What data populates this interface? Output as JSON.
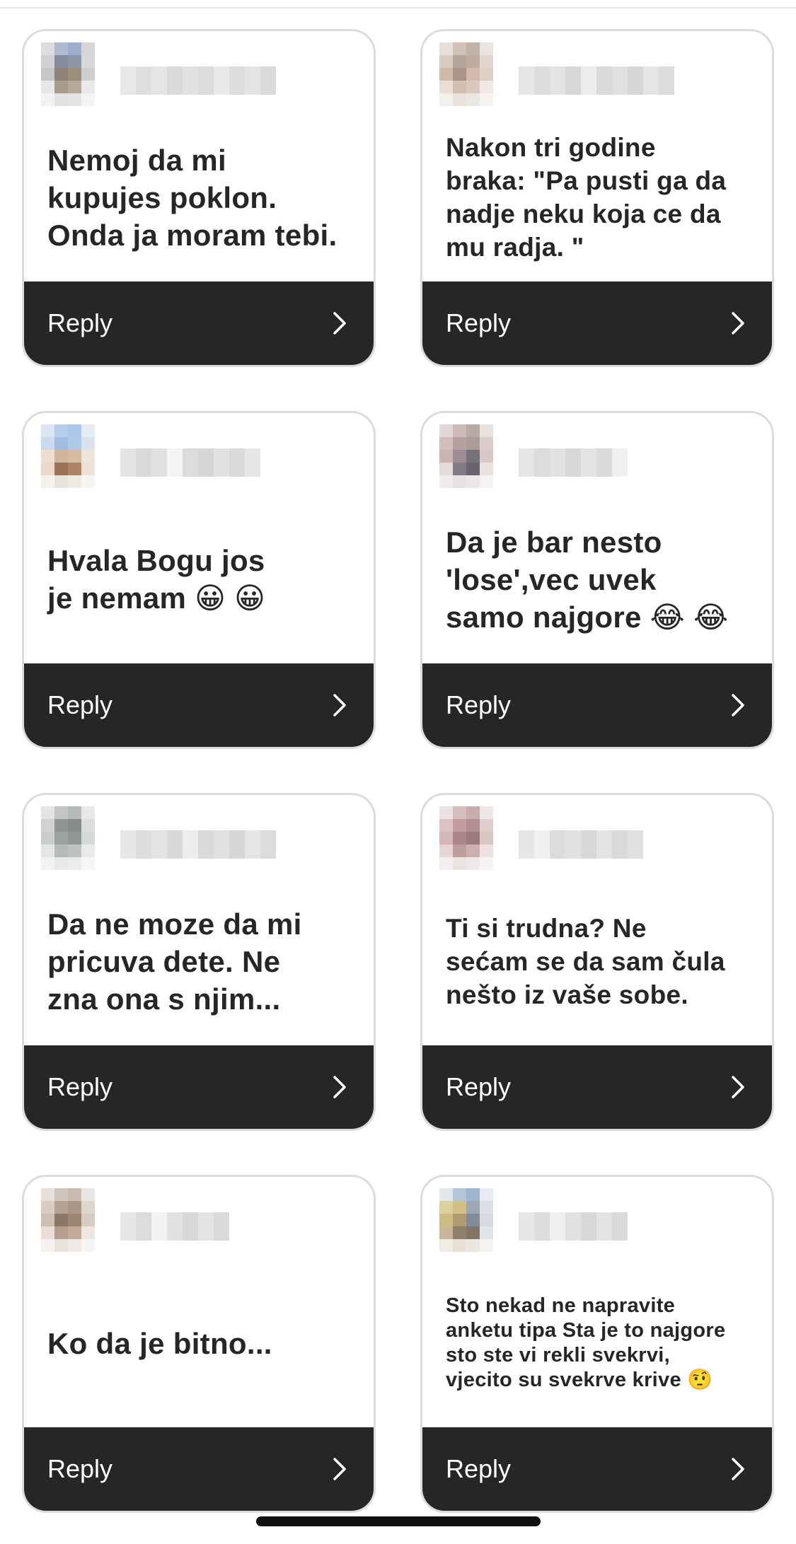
{
  "reply_label": "Reply",
  "cards": [
    {
      "text": "Nemoj da mi\nkupujes poklon.\nOnda ja moram tebi.",
      "size": "large",
      "avatar_colors": [
        "#d8d8d8",
        "#9fb0cc",
        "#8aa0c4",
        "#cfcfcf",
        "#c9c9c9",
        "#6f7a8c",
        "#7c8496",
        "#d2d2d2",
        "#bdbdbd",
        "#7b6e5e",
        "#8c7b66",
        "#c7c7c7",
        "#e3e3e3",
        "#9a8a74",
        "#a89a86",
        "#e6e6e6",
        "#f0f0f0",
        "#dcdcdc",
        "#e0e0e0",
        "#f2f2f2"
      ],
      "username_blocks": [
        "#e8e8e8",
        "#dedede",
        "#e5e5e5",
        "#d9d9d9",
        "#e2e2e2",
        "#dcdcdc",
        "#e9e9e9",
        "#dddddd",
        "#e4e4e4",
        "#dadada"
      ]
    },
    {
      "text": "Nakon tri godine\nbraka: \"Pa pusti ga da\nnadje neku koja ce da\nmu radja. \"",
      "size": "medium",
      "avatar_colors": [
        "#e4dad4",
        "#c9b8ad",
        "#b7a69a",
        "#e6e0da",
        "#d3c2b6",
        "#a8978a",
        "#b69e8c",
        "#dccfc5",
        "#c7ae9c",
        "#9c8271",
        "#c8b09e",
        "#d9c7b9",
        "#e8d9cd",
        "#c9b4a5",
        "#d4c0b1",
        "#eee5de",
        "#f3efeb",
        "#e7ded7",
        "#ebe3dc",
        "#f6f2ef"
      ],
      "username_blocks": [
        "#e6e6e6",
        "#dddddd",
        "#e3e3e3",
        "#d8d8d8",
        "#ececec",
        "#dadada",
        "#e0e0e0",
        "#d6d6d6",
        "#e5e5e5",
        "#dcdcdc"
      ]
    },
    {
      "text": "Hvala Bogu jos\nje nemam 😀 😀",
      "size": "large",
      "avatar_colors": [
        "#d6e2f0",
        "#a9c6ea",
        "#9dbde6",
        "#e2e9f2",
        "#c3d4ea",
        "#8fb2e0",
        "#a4c0e6",
        "#d5dfec",
        "#e9d9c8",
        "#c8a98a",
        "#cfb194",
        "#eae0d6",
        "#e7d2bf",
        "#8a5a3a",
        "#a06e4c",
        "#ecdccc",
        "#f3eee8",
        "#e6dfd8",
        "#ede6df",
        "#f7f3ef"
      ],
      "username_blocks": [
        "#e4e4e4",
        "#d9d9d9",
        "#e0e0e0",
        "#f5f5f5",
        "#dcdcdc",
        "#d6d6d6",
        "#e2e2e2",
        "#dadada",
        "#e6e6e6"
      ]
    },
    {
      "text": "Da je bar nesto\n'lose',vec uvek\nsamo najgore 😂 😂",
      "size": "large",
      "avatar_colors": [
        "#dcd2d0",
        "#c2aeab",
        "#b09a95",
        "#e3dcda",
        "#c9b3ae",
        "#a9918c",
        "#9f8a85",
        "#d4c6c2",
        "#c1a9a4",
        "#8e7a82",
        "#5e5a66",
        "#cfc0bc",
        "#e0d6d3",
        "#6b6470",
        "#4d4a56",
        "#e5dcd9",
        "#efebea",
        "#e2dddc",
        "#e8e3e2",
        "#f4f1f0"
      ],
      "username_blocks": [
        "#e6e6e6",
        "#dcdcdc",
        "#e2e2e2",
        "#d8d8d8",
        "#e4e4e4",
        "#dadada",
        "#f0f0f0"
      ]
    },
    {
      "text": "Da ne moze da mi\npricuva dete. Ne\nzna ona s njim...",
      "size": "large",
      "avatar_colors": [
        "#dfe0df",
        "#b9bcba",
        "#a9adab",
        "#e3e4e3",
        "#c9ccca",
        "#7d8581",
        "#6f7874",
        "#d6d8d7",
        "#c2c5c3",
        "#8a938f",
        "#7e8783",
        "#cfd2d0",
        "#e0e2e1",
        "#a8afab",
        "#b3b9b6",
        "#e6e8e7",
        "#eff0ef",
        "#e4e5e4",
        "#e8e9e8",
        "#f4f5f4"
      ],
      "username_blocks": [
        "#e6e6e6",
        "#dddddd",
        "#e3e3e3",
        "#d8d8d8",
        "#ececec",
        "#dadada",
        "#e0e0e0",
        "#d6d6d6",
        "#e5e5e5",
        "#dcdcdc"
      ]
    },
    {
      "text": "Ti si trudna? Ne\nsećam se da sam čula\nnešto iz vaše sobe.",
      "size": "medium",
      "avatar_colors": [
        "#e8dcdc",
        "#cfb2b2",
        "#c19e9e",
        "#eae2e2",
        "#d6b8b8",
        "#b88c8c",
        "#a87c7c",
        "#dcc6c6",
        "#cfaaa8",
        "#9e7272",
        "#8c6464",
        "#d4bcbc",
        "#e2d0d0",
        "#b48c8a",
        "#c4a2a0",
        "#ecdede",
        "#f3ecec",
        "#e8dede",
        "#ede5e5",
        "#f7f2f2"
      ],
      "username_blocks": [
        "#e6e6e6",
        "#f0f0f0",
        "#dcdcdc",
        "#e2e2e2",
        "#d8d8d8",
        "#e4e4e4",
        "#dadada",
        "#e0e0e0"
      ]
    },
    {
      "text": "Ko da je bitno...",
      "size": "large",
      "avatar_colors": [
        "#e2dcd8",
        "#c8bcb4",
        "#bcae a4",
        "#e6e1dd",
        "#d2c4b9",
        "#a89280",
        "#9c8472",
        "#dacfc6",
        "#c7b4a5",
        "#7a604c",
        "#8c705a",
        "#d2c2b5",
        "#e4dad2",
        "#a88e7a",
        "#b89c86",
        "#ebe3dc",
        "#f3efeb",
        "#e6dfd9",
        "#ebe5e0",
        "#f6f3f0"
      ],
      "username_blocks": [
        "#e6e6e6",
        "#dcdcdc",
        "#f2f2f2",
        "#e2e2e2",
        "#d8d8d8",
        "#e4e4e4",
        "#dadada"
      ]
    },
    {
      "text": "Sto nekad ne napravite\nanketu tipa Sta je to najgore\nsto ste vi rekli svekrvi,\nvjecito su svekrve krive 🤨",
      "size": "small",
      "avatar_colors": [
        "#dfe4ea",
        "#a8bcd4",
        "#8ea8c8",
        "#e3e8ed",
        "#d8c88e",
        "#c9b472",
        "#8b98a8",
        "#d6dbe0",
        "#c8b06c",
        "#a08a5a",
        "#6a7888",
        "#cfd4d9",
        "#c2a884",
        "#7c6a52",
        "#6e5c48",
        "#dde1e5",
        "#efe9e2",
        "#e4dcd2",
        "#e8e2db",
        "#f4f1ed"
      ],
      "username_blocks": [
        "#e6e6e6",
        "#dddddd",
        "#f0f0f0",
        "#e2e2e2",
        "#d8d8d8",
        "#e4e4e4",
        "#dadada"
      ]
    }
  ]
}
